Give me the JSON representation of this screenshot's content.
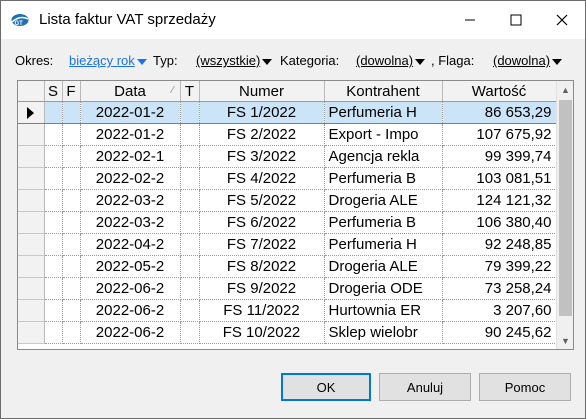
{
  "window": {
    "title": "Lista faktur VAT sprzedaży",
    "colors": {
      "selection": "#cce4f7",
      "link": "#1a73e8",
      "default_button_border": "#0078d7"
    }
  },
  "filters": {
    "period_label": "Okres:",
    "period_value": "bieżący rok",
    "type_label": "Typ:",
    "type_value": "(wszystkie)",
    "category_label": "Kategoria:",
    "category_value": "(dowolna)",
    "flag_label": ", Flaga:",
    "flag_value": "(dowolna)"
  },
  "table": {
    "headers": [
      "S",
      "F",
      "Data",
      "T",
      "Numer",
      "Kontrahent",
      "Wartość"
    ],
    "rows": [
      {
        "date": "2022-01-2",
        "number": "FS 1/2022",
        "contractor": "Perfumeria H",
        "value": "86 653,29",
        "selected": true
      },
      {
        "date": "2022-01-2",
        "number": "FS 2/2022",
        "contractor": "Export - Impo",
        "value": "107 675,92"
      },
      {
        "date": "2022-02-1",
        "number": "FS 3/2022",
        "contractor": "Agencja rekla",
        "value": "99 399,74"
      },
      {
        "date": "2022-02-2",
        "number": "FS 4/2022",
        "contractor": "Perfumeria B",
        "value": "103 081,51"
      },
      {
        "date": "2022-03-2",
        "number": "FS 5/2022",
        "contractor": "Drogeria ALE",
        "value": "124 121,32"
      },
      {
        "date": "2022-03-2",
        "number": "FS 6/2022",
        "contractor": "Perfumeria B",
        "value": "106 380,40"
      },
      {
        "date": "2022-04-2",
        "number": "FS 7/2022",
        "contractor": "Perfumeria H",
        "value": "92 248,85"
      },
      {
        "date": "2022-05-2",
        "number": "FS 8/2022",
        "contractor": "Drogeria ALE",
        "value": "79 399,22"
      },
      {
        "date": "2022-06-2",
        "number": "FS 9/2022",
        "contractor": "Drogeria ODE",
        "value": "73 258,24"
      },
      {
        "date": "2022-06-2",
        "number": "FS 11/2022",
        "contractor": "Hurtownia ER",
        "value": "3 207,60"
      },
      {
        "date": "2022-06-2",
        "number": "FS 10/2022",
        "contractor": "Sklep wielobr",
        "value": "90 245,62"
      }
    ]
  },
  "buttons": {
    "ok": "OK",
    "cancel": "Anuluj",
    "help": "Pomoc"
  },
  "icons": {
    "app": "app-logo-icon",
    "minimize": "minimize-icon",
    "maximize": "maximize-icon",
    "close": "close-icon"
  }
}
